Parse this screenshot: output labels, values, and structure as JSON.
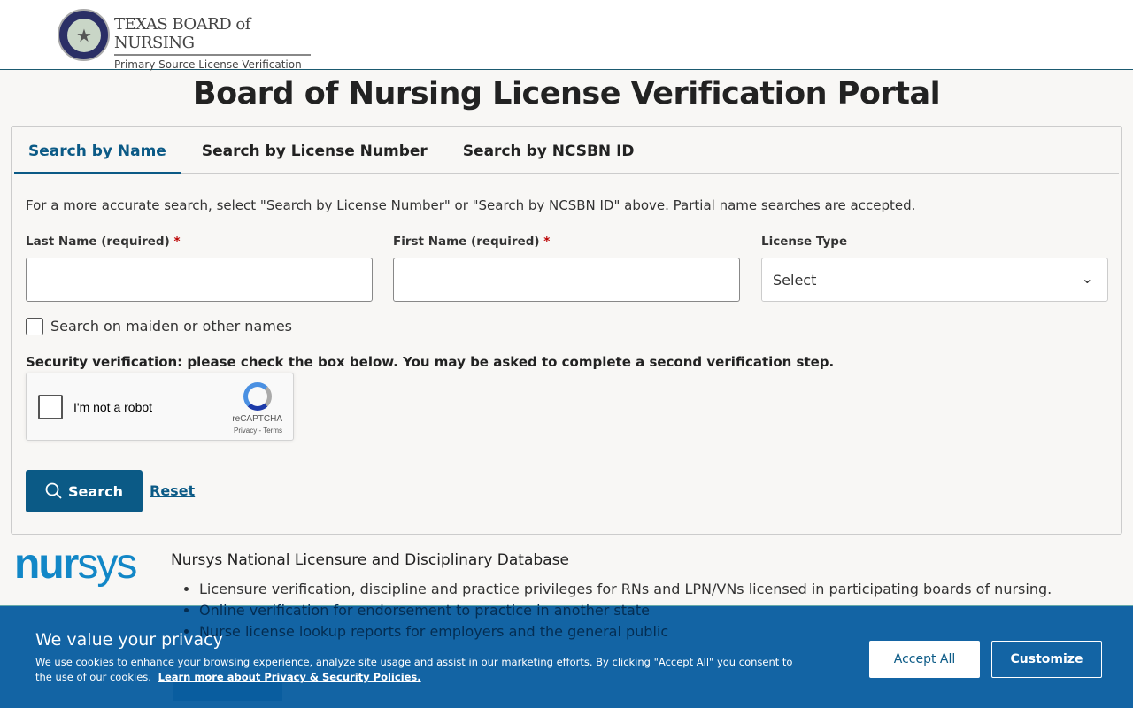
{
  "header": {
    "brand_title": "TEXAS BOARD of NURSING",
    "brand_subtitle": "Primary Source License Verification",
    "seal_text": "BOARD OF NURSING TEXAS"
  },
  "page_title": "Board of Nursing License Verification Portal",
  "tabs": [
    {
      "label": "Search by Name",
      "active": true
    },
    {
      "label": "Search by License Number"
    },
    {
      "label": "Search by NCSBN ID"
    }
  ],
  "form": {
    "hint": "For a more accurate search, select \"Search by License Number\" or \"Search by NCSBN ID\" above. Partial name searches are accepted.",
    "last_name_label": "Last Name (required)",
    "first_name_label": "First Name (required)",
    "required_mark": "*",
    "license_type_label": "License Type",
    "license_type_value": "Select",
    "maiden_label": "Search on maiden or other names",
    "security_text": "Security verification: please check the box below. You may be asked to complete a second verification step.",
    "captcha": {
      "label": "I'm not a robot",
      "brand": "reCAPTCHA",
      "links": "Privacy - Terms"
    },
    "search_label": "Search",
    "reset_label": "Reset"
  },
  "nursys": {
    "logo": "nursys",
    "title": "Nursys National Licensure and Disciplinary Database",
    "items": [
      "Licensure verification, discipline and practice privileges for RNs and LPN/VNs licensed in participating boards of nursing.",
      "Online verification for endorsement to practice in another state",
      "Nurse license lookup reports for employers and the general public"
    ]
  },
  "cookie": {
    "title": "We value your privacy",
    "text": "We use cookies to enhance your browsing experience, analyze site usage and assist in our marketing efforts. By clicking \"Accept All\" you consent to the use of our cookies.",
    "link": "Learn more about Privacy & Security Policies.",
    "accept": "Accept All",
    "customize": "Customize"
  }
}
